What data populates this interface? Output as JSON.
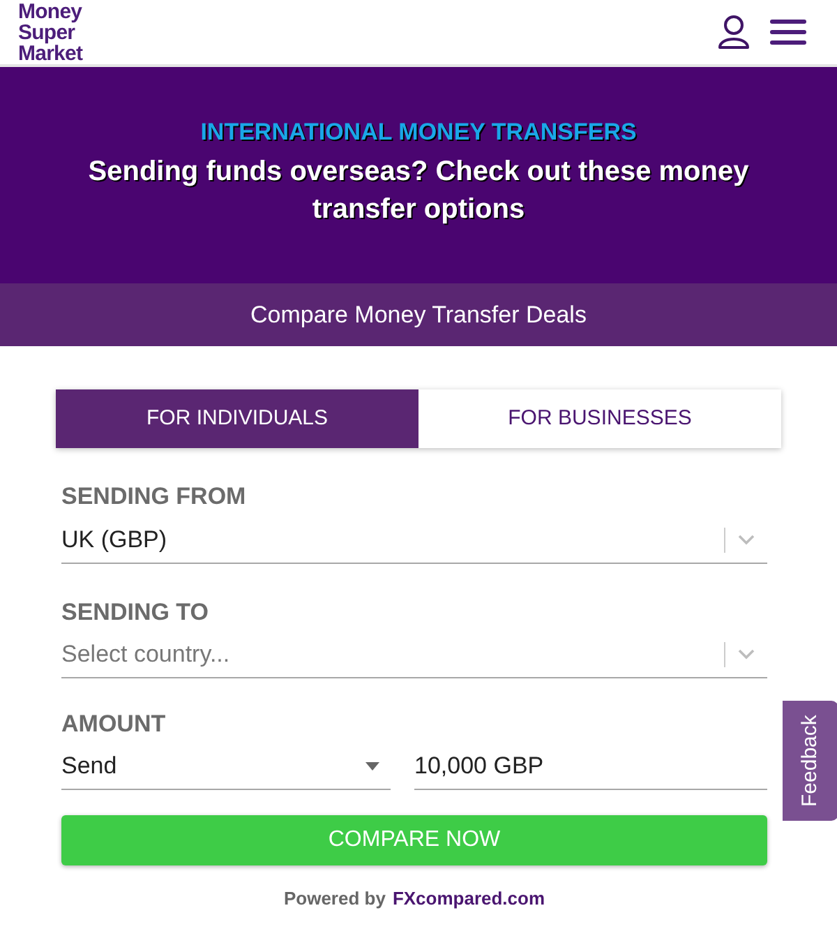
{
  "header": {
    "logo_lines": [
      "Money",
      "Super",
      "Market"
    ]
  },
  "hero": {
    "kicker": "INTERNATIONAL MONEY TRANSFERS",
    "title": "Sending funds overseas? Check out these money transfer options"
  },
  "compare_bar": {
    "label": "Compare Money Transfer Deals"
  },
  "tabs": [
    {
      "label": "FOR INDIVIDUALS",
      "selected": true
    },
    {
      "label": "FOR BUSINESSES",
      "selected": false
    }
  ],
  "fields": [
    {
      "label": "SENDING FROM",
      "value": "UK (GBP)"
    },
    {
      "label": "SENDING TO",
      "placeholder": "Select country..."
    }
  ],
  "amount": {
    "label": "AMOUNT",
    "mode": "Send",
    "value": "10,000 GBP"
  },
  "compare_button": "COMPARE NOW",
  "footer": {
    "prefix": "Powered by",
    "link": "FXcompared.com"
  },
  "feedback_tab": "Feedback"
}
